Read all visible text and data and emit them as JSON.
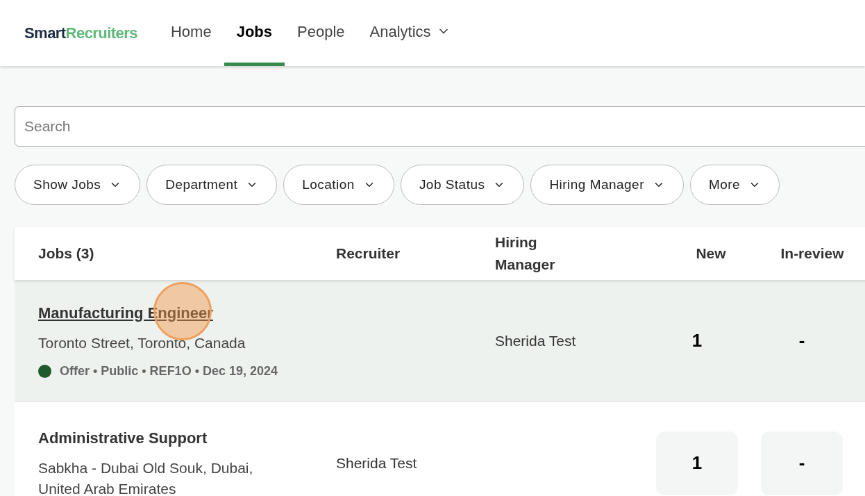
{
  "logo": {
    "part_1": "Smart",
    "part_2": "Recruiters"
  },
  "nav": [
    {
      "label": "Home",
      "selected": false,
      "dropdown": false
    },
    {
      "label": "Jobs",
      "selected": true,
      "dropdown": false
    },
    {
      "label": "People",
      "selected": false,
      "dropdown": false
    },
    {
      "label": "Analytics",
      "selected": false,
      "dropdown": true
    }
  ],
  "search": {
    "placeholder": "Search"
  },
  "filters": [
    "Show Jobs",
    "Department",
    "Location",
    "Job Status",
    "Hiring Manager",
    "More"
  ],
  "table": {
    "columns": [
      "Jobs (3)",
      "Recruiter",
      "Hiring Manager",
      "New",
      "In-review"
    ],
    "rows": [
      {
        "title": "Manufacturing Engineer",
        "link": true,
        "highlighted": true,
        "location": "Toronto Street, Toronto, Canada",
        "status": {
          "text": "Offer • Public • REF1O • Dec 19, 2024",
          "color": "#1f5a2a"
        },
        "recruiter": "",
        "hiring_manager": "Sherida Test",
        "new": "1",
        "in_review": "-",
        "click_marker": true
      },
      {
        "title": "Administrative Support",
        "link": false,
        "highlighted": false,
        "location": "Sabkha - Dubai Old Souk, Dubai, United Arab Emirates",
        "recruiter": "Sherida Test",
        "hiring_manager": "",
        "new": "1",
        "in_review": "-",
        "click_marker": false
      }
    ]
  }
}
